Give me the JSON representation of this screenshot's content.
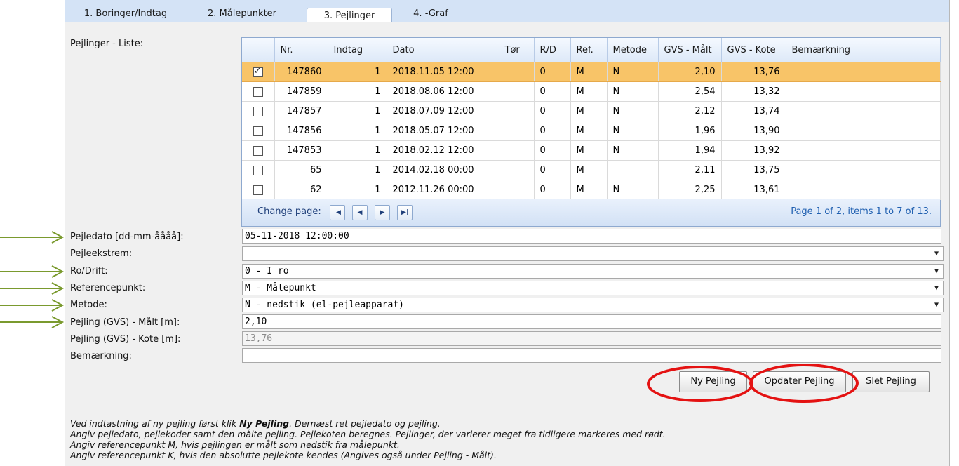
{
  "tabs": [
    {
      "label": "1. Boringer/Indtag"
    },
    {
      "label": "2. Målepunkter"
    },
    {
      "label": "3. Pejlinger"
    },
    {
      "label": "4. -Graf"
    }
  ],
  "list_label": "Pejlinger - Liste:",
  "grid": {
    "headers": [
      "",
      "Nr.",
      "Indtag",
      "Dato",
      "Tør",
      "R/D",
      "Ref.",
      "Metode",
      "GVS - Målt",
      "GVS - Kote",
      "Bemærkning"
    ],
    "rows": [
      {
        "checked": true,
        "nr": "147860",
        "indtag": "1",
        "dato": "2018.11.05 12:00",
        "tor": "",
        "rd": "0",
        "ref": "M",
        "metode": "N",
        "gvs_maalt": "2,10",
        "gvs_kote": "13,76",
        "bem": ""
      },
      {
        "checked": false,
        "nr": "147859",
        "indtag": "1",
        "dato": "2018.08.06 12:00",
        "tor": "",
        "rd": "0",
        "ref": "M",
        "metode": "N",
        "gvs_maalt": "2,54",
        "gvs_kote": "13,32",
        "bem": ""
      },
      {
        "checked": false,
        "nr": "147857",
        "indtag": "1",
        "dato": "2018.07.09 12:00",
        "tor": "",
        "rd": "0",
        "ref": "M",
        "metode": "N",
        "gvs_maalt": "2,12",
        "gvs_kote": "13,74",
        "bem": ""
      },
      {
        "checked": false,
        "nr": "147856",
        "indtag": "1",
        "dato": "2018.05.07 12:00",
        "tor": "",
        "rd": "0",
        "ref": "M",
        "metode": "N",
        "gvs_maalt": "1,96",
        "gvs_kote": "13,90",
        "bem": ""
      },
      {
        "checked": false,
        "nr": "147853",
        "indtag": "1",
        "dato": "2018.02.12 12:00",
        "tor": "",
        "rd": "0",
        "ref": "M",
        "metode": "N",
        "gvs_maalt": "1,94",
        "gvs_kote": "13,92",
        "bem": ""
      },
      {
        "checked": false,
        "nr": "65",
        "indtag": "1",
        "dato": "2014.02.18 00:00",
        "tor": "",
        "rd": "0",
        "ref": "M",
        "metode": "",
        "gvs_maalt": "2,11",
        "gvs_kote": "13,75",
        "bem": ""
      },
      {
        "checked": false,
        "nr": "62",
        "indtag": "1",
        "dato": "2012.11.26 00:00",
        "tor": "",
        "rd": "0",
        "ref": "M",
        "metode": "N",
        "gvs_maalt": "2,25",
        "gvs_kote": "13,61",
        "bem": ""
      }
    ],
    "pager": {
      "change_page": "Change page:",
      "info": "Page 1 of 2, items 1 to 7 of 13."
    }
  },
  "form": {
    "pejledato": {
      "label": "Pejledato [dd-mm-åååå]:",
      "value": "05-11-2018 12:00:00"
    },
    "pejleekstrem": {
      "label": "Pejleekstrem:",
      "value": ""
    },
    "ro_drift": {
      "label": "Ro/Drift:",
      "value": "0 - I ro"
    },
    "referencepunkt": {
      "label": "Referencepunkt:",
      "value": "M - Målepunkt"
    },
    "metode": {
      "label": "Metode:",
      "value": "N - nedstik (el-pejleapparat)"
    },
    "gvs_maalt": {
      "label": "Pejling (GVS) - Målt [m]:",
      "value": "2,10"
    },
    "gvs_kote": {
      "label": "Pejling (GVS) - Kote [m]:",
      "value": "13,76"
    },
    "bemaerkning": {
      "label": "Bemærkning:",
      "value": ""
    }
  },
  "buttons": {
    "ny": "Ny Pejling",
    "opdater": "Opdater Pejling",
    "slet": "Slet Pejling"
  },
  "notes": {
    "line1_pre": "Ved indtastning af ny pejling først klik ",
    "line1_bold": "Ny Pejling",
    "line1_post": ". Dernæst ret pejledato og pejling.",
    "line2": "Angiv pejledato, pejlekoder samt den målte pejling. Pejlekoten beregnes. Pejlinger, der varierer meget fra tidligere markeres med rødt.",
    "line3": "Angiv referencepunkt M, hvis pejlingen er målt som nedstik fra målepunkt.",
    "line4": "Angiv referencepunkt K, hvis den absolutte pejlekote kendes (Angives også under Pejling - Målt)."
  },
  "colors": {
    "selected_row": "#f8c468",
    "annotation_arrow": "#7a9a2e",
    "annotation_ring": "#e41212"
  }
}
